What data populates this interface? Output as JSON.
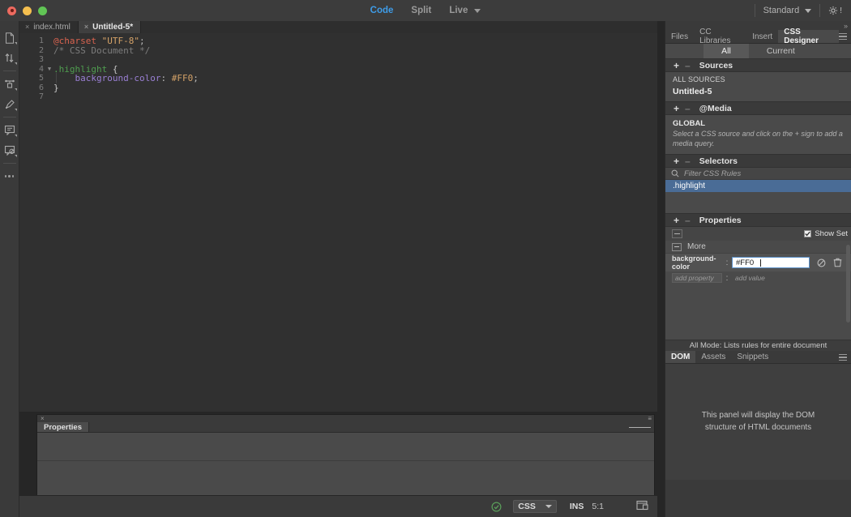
{
  "titlebar": {
    "view_modes": [
      {
        "label": "Code",
        "active": true
      },
      {
        "label": "Split",
        "active": false
      },
      {
        "label": "Live",
        "active": false
      }
    ],
    "workspace": "Standard",
    "gear_badge": "!"
  },
  "rail": {
    "icons": [
      "file-icon",
      "sort-arrows-icon",
      "format-source-icon",
      "apply-comment-icon",
      "comment-icon",
      "remove-comment-icon",
      "more-icon"
    ]
  },
  "tabs": [
    {
      "label": "index.html",
      "active": false,
      "close": "×"
    },
    {
      "label": "Untitled-5*",
      "active": true,
      "close": "×"
    }
  ],
  "code": {
    "lines": [
      {
        "num": "1",
        "fold": "",
        "tokens": [
          {
            "t": "@charset",
            "c": "t-at"
          },
          {
            "t": " ",
            "c": "ctext"
          },
          {
            "t": "\"UTF-8\"",
            "c": "t-str"
          },
          {
            "t": ";",
            "c": "t-punc"
          }
        ]
      },
      {
        "num": "2",
        "fold": "",
        "tokens": [
          {
            "t": "/* CSS Document */",
            "c": "t-cmt"
          }
        ]
      },
      {
        "num": "3",
        "fold": "",
        "tokens": []
      },
      {
        "num": "4",
        "fold": "▼",
        "tokens": [
          {
            "t": ".highlight",
            "c": "t-sel"
          },
          {
            "t": " ",
            "c": "ctext"
          },
          {
            "t": "{",
            "c": "t-brace"
          }
        ]
      },
      {
        "num": "5",
        "fold": "",
        "tokens": [
          {
            "t": "│   ",
            "c": "indent-guide"
          },
          {
            "t": "background-color",
            "c": "t-prop"
          },
          {
            "t": ": ",
            "c": "t-punc"
          },
          {
            "t": "#FF0",
            "c": "t-val"
          },
          {
            "t": ";",
            "c": "t-punc"
          }
        ]
      },
      {
        "num": "6",
        "fold": "",
        "tokens": [
          {
            "t": "}",
            "c": "t-brace"
          }
        ]
      },
      {
        "num": "7",
        "fold": "",
        "tokens": []
      }
    ]
  },
  "properties_dock": {
    "close": "×",
    "tab_label": "Properties"
  },
  "statusbar": {
    "validator_icon": "check-circle-icon",
    "doc_type": "CSS",
    "insert_mode": "INS",
    "cursor_position": "5:1",
    "window_size_icon": "window-size-icon"
  },
  "dock": {
    "tabs": [
      {
        "label": "Files",
        "active": false
      },
      {
        "label": "CC Libraries",
        "active": false
      },
      {
        "label": "Insert",
        "active": false
      },
      {
        "label": "CSS Designer",
        "active": true
      }
    ],
    "mode_buttons": [
      {
        "label": "All",
        "active": true
      },
      {
        "label": "Current",
        "active": false
      }
    ],
    "sources": {
      "title": "Sources",
      "all_sources_label": "ALL SOURCES",
      "items": [
        "Untitled-5"
      ]
    },
    "media": {
      "title": "@Media",
      "global_label": "GLOBAL",
      "hint": "Select a CSS source and click on the + sign to add a media query."
    },
    "selectors": {
      "title": "Selectors",
      "filter_placeholder": "Filter CSS Rules",
      "items": [
        {
          "label": ".highlight",
          "selected": true
        }
      ]
    },
    "properties": {
      "title": "Properties",
      "show_set_label": "Show Set",
      "show_set_checked": true,
      "more_label": "More",
      "rows": [
        {
          "name": "background-color",
          "value": "#FF0",
          "disable_icon": "disable-icon",
          "delete_icon": "trash-icon"
        }
      ],
      "add_property_placeholder": "add property",
      "add_value_placeholder": "add value"
    },
    "all_mode_note": "All Mode: Lists rules for entire document",
    "bottom_tabs": [
      {
        "label": "DOM",
        "active": true
      },
      {
        "label": "Assets",
        "active": false
      },
      {
        "label": "Snippets",
        "active": false
      }
    ],
    "dom_empty_message": "This panel will display the DOM structure of HTML documents"
  },
  "colors": {
    "accent_blue": "#3e9ce8",
    "selection_blue": "#4a6c96",
    "value_orange": "#d4a268",
    "selector_green": "#4f9d4f",
    "property_purple": "#9a7fd4"
  }
}
